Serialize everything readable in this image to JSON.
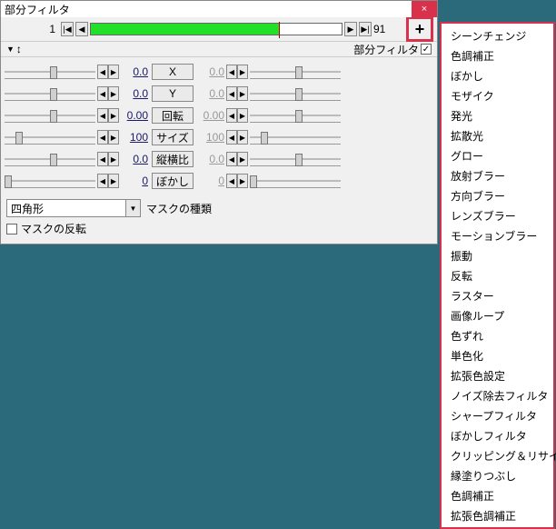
{
  "title": "部分フィルタ",
  "timeline": {
    "start": "1",
    "end": "91"
  },
  "header": {
    "label": "部分フィルタ"
  },
  "params": [
    {
      "name": "X",
      "v1": "0.0",
      "v2": "0.0",
      "t1": 50,
      "t2": 50
    },
    {
      "name": "Y",
      "v1": "0.0",
      "v2": "0.0",
      "t1": 50,
      "t2": 50
    },
    {
      "name": "回転",
      "v1": "0.00",
      "v2": "0.00",
      "t1": 50,
      "t2": 50
    },
    {
      "name": "サイズ",
      "v1": "100",
      "v2": "100",
      "t1": 12,
      "t2": 12
    },
    {
      "name": "縦横比",
      "v1": "0.0",
      "v2": "0.0",
      "t1": 50,
      "t2": 50
    },
    {
      "name": "ぼかし",
      "v1": "0",
      "v2": "0",
      "t1": 0,
      "t2": 0
    }
  ],
  "mask": {
    "label": "マスクの種類",
    "value": "四角形",
    "invert": "マスクの反転"
  },
  "menu": [
    "シーンチェンジ",
    "色調補正",
    "ぼかし",
    "モザイク",
    "発光",
    "拡散光",
    "グロー",
    "放射ブラー",
    "方向ブラー",
    "レンズブラー",
    "モーションブラー",
    "振動",
    "反転",
    "ラスター",
    "画像ループ",
    "色ずれ",
    "単色化",
    "拡張色設定",
    "ノイズ除去フィルタ",
    "シャープフィルタ",
    "ぼかしフィルタ",
    "クリッピング＆リサイズ",
    "縁塗りつぶし",
    "色調補正",
    "拡張色調補正"
  ]
}
